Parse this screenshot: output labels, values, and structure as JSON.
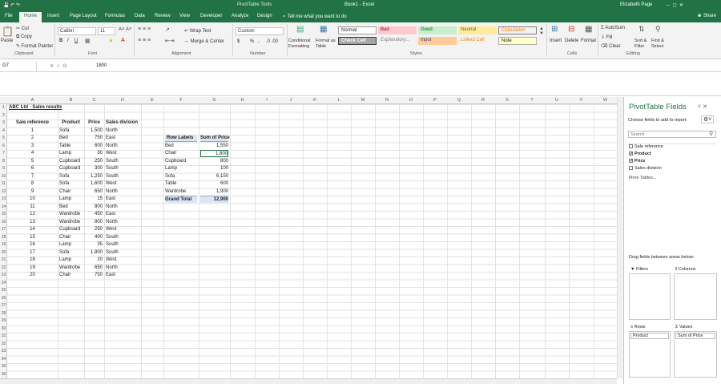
{
  "window": {
    "title": "Book1 - Excel",
    "context": "PivotTable Tools",
    "user": "Elizabeth Page"
  },
  "tabs": [
    "File",
    "Home",
    "Insert",
    "Page Layout",
    "Formulas",
    "Data",
    "Review",
    "View",
    "Developer",
    "Analyze",
    "Design"
  ],
  "tell_me": "Tell me what you want to do",
  "share": "Share",
  "clipboard": {
    "paste": "Paste",
    "cut": "Cut",
    "copy": "Copy",
    "format_painter": "Format Painter",
    "group": "Clipboard"
  },
  "font": {
    "name": "Calibri",
    "size": "11",
    "group": "Font"
  },
  "alignment": {
    "wrap": "Wrap Text",
    "merge": "Merge & Center",
    "group": "Alignment"
  },
  "number": {
    "format": "Custom",
    "group": "Number",
    "percent": "%",
    "comma": ","
  },
  "styles": {
    "group": "Styles",
    "conditional": "Conditional Formatting",
    "format_table": "Format as Table",
    "normal": "Normal",
    "bad": "Bad",
    "good": "Good",
    "neutral": "Neutral",
    "calculation": "Calculation",
    "check_cell": "Check Cell",
    "explanatory": "Explanatory...",
    "input": "Input",
    "linked": "Linked Cell",
    "note": "Note"
  },
  "cells": {
    "insert": "Insert",
    "delete": "Delete",
    "format": "Format",
    "group": "Cells"
  },
  "editing": {
    "autosum": "AutoSum",
    "fill": "Fill",
    "clear": "Clear",
    "sort": "Sort & Filter",
    "find": "Find & Select",
    "group": "Editing"
  },
  "formula_bar": {
    "name_box": "G7",
    "fx": "fx",
    "value": "1800"
  },
  "columns": [
    "A",
    "B",
    "C",
    "D",
    "E",
    "F",
    "G",
    "H",
    "I",
    "J",
    "K",
    "L",
    "M",
    "N",
    "O",
    "P",
    "Q",
    "R",
    "S",
    "T",
    "U",
    "V",
    "W"
  ],
  "sheet": {
    "title": "ABC Ltd - Sales results",
    "headers": {
      "ref": "Sale reference",
      "product": "Product",
      "price": "Price",
      "division": "Sales division"
    },
    "rows": [
      [
        "1",
        "Sofa",
        "1,500",
        "North"
      ],
      [
        "2",
        "Bed",
        "750",
        "East"
      ],
      [
        "3",
        "Table",
        "600",
        "North"
      ],
      [
        "4",
        "Lamp",
        "30",
        "West"
      ],
      [
        "5",
        "Cupboard",
        "250",
        "South"
      ],
      [
        "6",
        "Cupboard",
        "300",
        "South"
      ],
      [
        "7",
        "Sofa",
        "1,250",
        "South"
      ],
      [
        "8",
        "Sofa",
        "1,600",
        "West"
      ],
      [
        "9",
        "Chair",
        "650",
        "North"
      ],
      [
        "10",
        "Lamp",
        "15",
        "East"
      ],
      [
        "11",
        "Bed",
        "800",
        "North"
      ],
      [
        "12",
        "Wardrobe",
        "450",
        "East"
      ],
      [
        "13",
        "Wardrobe",
        "800",
        "North"
      ],
      [
        "14",
        "Cupboard",
        "250",
        "West"
      ],
      [
        "15",
        "Chair",
        "400",
        "South"
      ],
      [
        "16",
        "Lamp",
        "35",
        "South"
      ],
      [
        "17",
        "Sofa",
        "1,800",
        "South"
      ],
      [
        "18",
        "Lamp",
        "20",
        "West"
      ],
      [
        "19",
        "Wardrobe",
        "650",
        "North"
      ],
      [
        "20",
        "Chair",
        "750",
        "East"
      ]
    ]
  },
  "pivot": {
    "row_labels": "Row Labels",
    "sum_label": "Sum of Price",
    "rows": [
      [
        "Bed",
        "1,550"
      ],
      [
        "Chair",
        "1,800"
      ],
      [
        "Cupboard",
        "800"
      ],
      [
        "Lamp",
        "100"
      ],
      [
        "Sofa",
        "6,150"
      ],
      [
        "Table",
        "600"
      ],
      [
        "Wardrobe",
        "1,900"
      ]
    ],
    "total_label": "Grand Total",
    "total": "12,900"
  },
  "pane": {
    "title": "PivotTable Fields",
    "choose": "Choose fields to add to report:",
    "search": "Search",
    "fields": [
      {
        "name": "Sale reference",
        "checked": false
      },
      {
        "name": "Product",
        "checked": true
      },
      {
        "name": "Price",
        "checked": true
      },
      {
        "name": "Sales division",
        "checked": false
      }
    ],
    "more": "More Tables...",
    "drag": "Drag fields between areas below:",
    "filters": "Filters",
    "columns": "Columns",
    "rows": "Rows",
    "values": "Values",
    "rows_field": "Product",
    "values_field": "Sum of Price"
  }
}
